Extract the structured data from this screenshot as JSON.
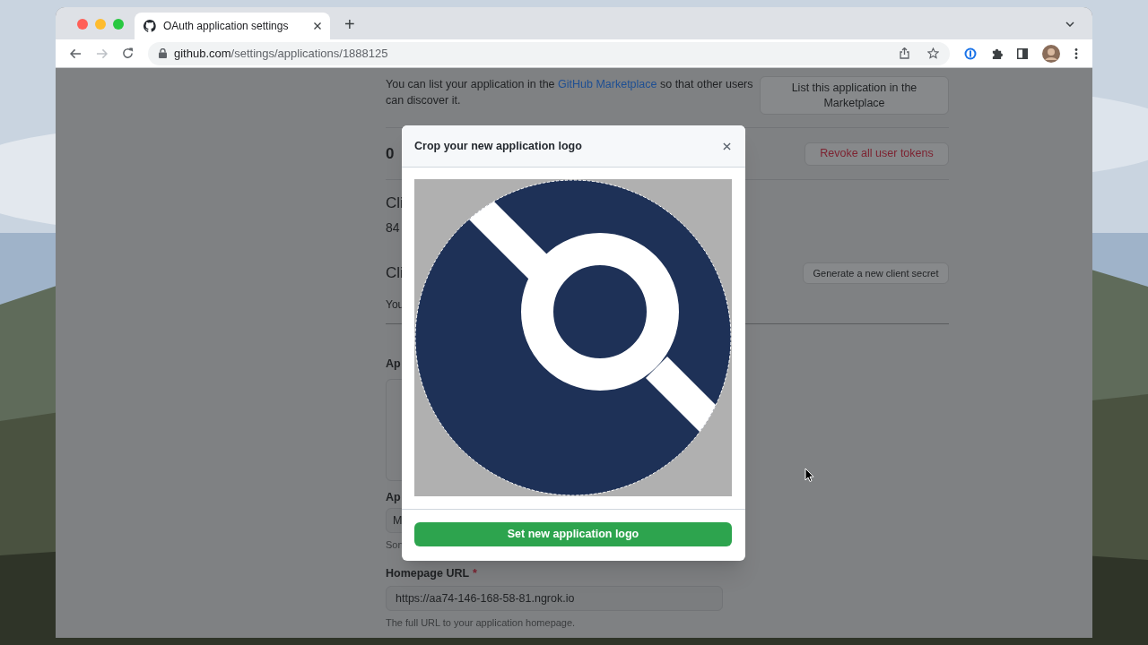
{
  "browser": {
    "tabs": [
      {
        "title": "OAuth application settings",
        "selected": true
      }
    ],
    "new_tab": "+",
    "url": {
      "domain": "github.com",
      "path": "/settings/applications/1888125"
    }
  },
  "page": {
    "marketplace": {
      "text": "You can list your application in the ",
      "link": "GitHub Marketplace",
      "text_after": " so that other users can discover it.",
      "button": "List this application in the Marketplace"
    },
    "tokens": {
      "heading": "0",
      "button": "Revoke all user tokens"
    },
    "client_id": {
      "heading": "Cli",
      "value": "84"
    },
    "client_secrets": {
      "heading": "Cli",
      "button": "Generate a new client secret",
      "text": "You"
    },
    "logo_label": "Ap",
    "name": {
      "label": "Ap",
      "value": "M",
      "hint": "Son"
    },
    "homepage": {
      "label": "Homepage URL",
      "required": "*",
      "value": "https://aa74-146-168-58-81.ngrok.io",
      "hint": "The full URL to your application homepage."
    }
  },
  "dialog": {
    "title": "Crop your new application logo",
    "button": "Set new application logo"
  }
}
